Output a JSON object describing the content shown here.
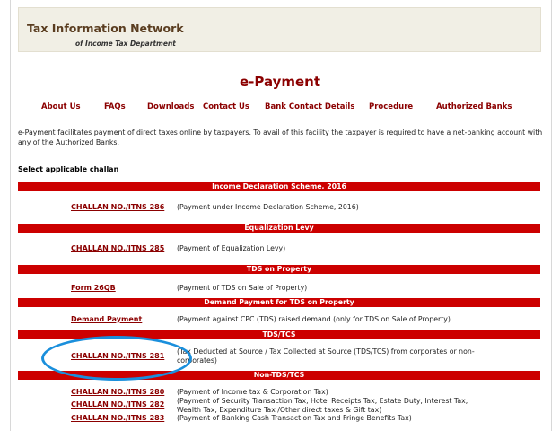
{
  "header": {
    "brand": "Tax Information Network",
    "dept": "of Income Tax Department"
  },
  "page_title": "e-Payment",
  "nav": [
    "About Us",
    "FAQs",
    "Downloads",
    "Contact Us",
    "Bank Contact Details",
    "Procedure",
    "Authorized Banks"
  ],
  "intro": "e-Payment facilitates payment of direct taxes online by taxpayers. To avail of this facility the taxpayer is required to have a net-banking account with any of the Authorized Banks.",
  "select_label": "Select applicable challan",
  "sections": [
    {
      "title": "Income Declaration Scheme, 2016",
      "rows": [
        {
          "link": "CHALLAN NO./ITNS 286",
          "desc": "(Payment under Income Declaration Scheme, 2016)"
        }
      ]
    },
    {
      "title": "Equalization Levy",
      "rows": [
        {
          "link": "CHALLAN NO./ITNS 285",
          "desc": "(Payment of Equalization Levy)"
        }
      ]
    },
    {
      "title": "TDS on Property",
      "rows": [
        {
          "link": "Form 26QB",
          "desc": "(Payment of TDS on Sale of Property)"
        }
      ]
    },
    {
      "title": "Demand Payment for TDS on Property",
      "rows": [
        {
          "link": "Demand Payment",
          "desc": "(Payment against CPC (TDS) raised demand (only for TDS on Sale of Property)"
        }
      ]
    },
    {
      "title": "TDS/TCS",
      "rows": [
        {
          "link": "CHALLAN NO./ITNS 281",
          "desc": "(Tax Deducted at Source / Tax Collected at Source (TDS/TCS) from corporates or non-corporates)"
        }
      ]
    },
    {
      "title": "Non-TDS/TCS",
      "rows": [
        {
          "link": "CHALLAN NO./ITNS 280",
          "desc": "(Payment of Income tax & Corporation Tax)"
        },
        {
          "link": "CHALLAN NO./ITNS 282",
          "desc": "(Payment of Security Transaction Tax, Hotel Receipts Tax, Estate Duty, Interest Tax, Wealth Tax, Expenditure Tax /Other direct taxes & Gift tax)"
        },
        {
          "link": "CHALLAN NO./ITNS 283",
          "desc": "(Payment of Banking Cash Transaction Tax and Fringe Benefits Tax)"
        }
      ]
    }
  ],
  "colors": {
    "section_bar": "#cc0000",
    "link": "#8b0000",
    "highlight_oval": "#1a8fdc",
    "header_bg": "#f1efe5"
  }
}
